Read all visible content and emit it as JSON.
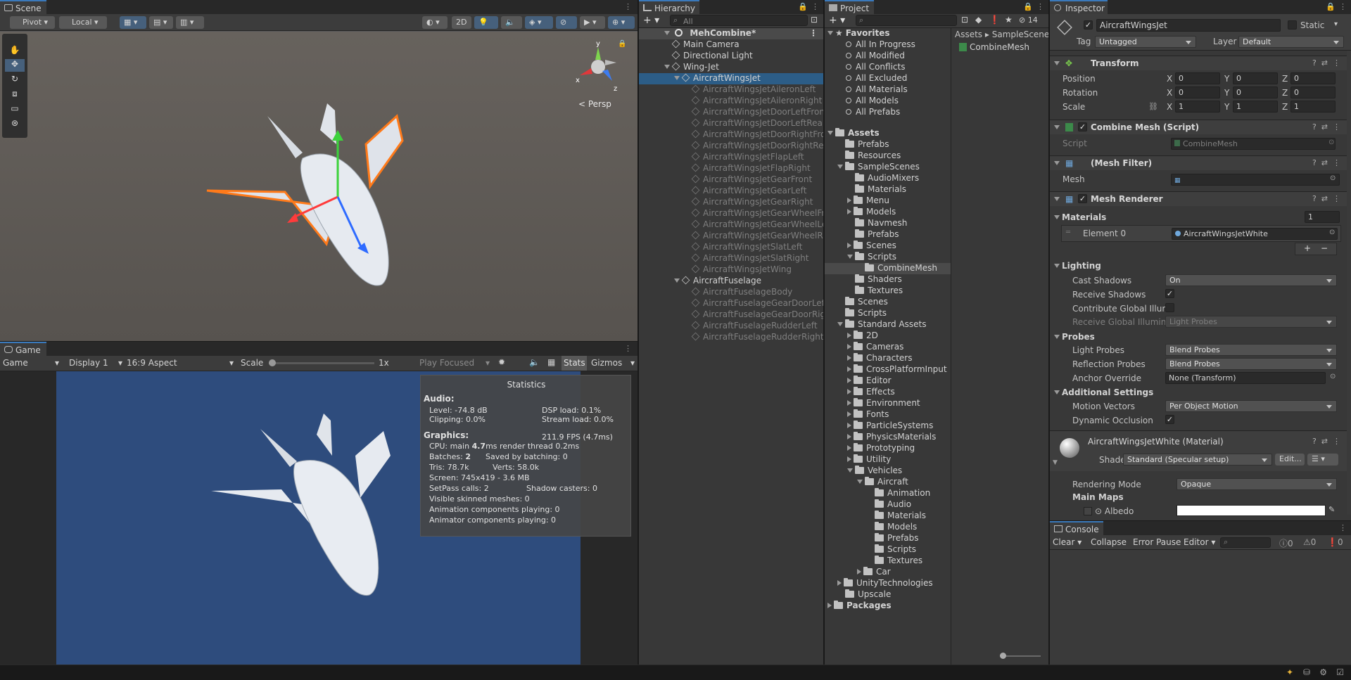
{
  "scene": {
    "tab_label": "Scene",
    "pivot_label": "Pivot",
    "local_label": "Local",
    "mode_2d": "2D",
    "persp_label": "< Persp",
    "gizmo_axes": [
      "y",
      "x",
      "z"
    ]
  },
  "game": {
    "tab_label": "Game",
    "mode": "Game",
    "display": "Display 1",
    "aspect": "16:9 Aspect",
    "scale_label": "Scale",
    "scale_value": "1x",
    "play_focused": "Play Focused",
    "stats_label": "Stats",
    "gizmos_label": "Gizmos",
    "background_color": "#2e4c7d",
    "statistics": {
      "title": "Statistics",
      "audio_header": "Audio:",
      "level": "Level: -74.8 dB",
      "dsp_load": "DSP load: 0.1%",
      "clipping": "Clipping: 0.0%",
      "stream_load": "Stream load: 0.0%",
      "graphics_header": "Graphics:",
      "fps": "211.9 FPS (4.7ms)",
      "cpu_prefix": "CPU: main",
      "cpu_main": "4.7",
      "cpu_suffix": "ms  render thread 0.2ms",
      "batches_prefix": "Batches:",
      "batches_value": "2",
      "saved_by_batching": "Saved by batching: 0",
      "tris": "Tris: 78.7k",
      "verts": "Verts: 58.0k",
      "screen": "Screen: 745x419 - 3.6 MB",
      "setpass": "SetPass calls: 2",
      "shadow_casters": "Shadow casters: 0",
      "skinned_meshes": "Visible skinned meshes: 0",
      "animation_components": "Animation components playing: 0",
      "animator_components": "Animator components playing: 0"
    }
  },
  "hierarchy": {
    "tab_label": "Hierarchy",
    "search_placeholder": "All",
    "scene_name": "MehCombine*",
    "items": [
      {
        "label": "Main Camera",
        "indent": 1,
        "dim": false,
        "fold": "none"
      },
      {
        "label": "Directional Light",
        "indent": 1,
        "dim": false,
        "fold": "none"
      },
      {
        "label": "Wing-Jet",
        "indent": 1,
        "dim": false,
        "fold": "open"
      },
      {
        "label": "AircraftWingsJet",
        "indent": 2,
        "dim": false,
        "fold": "open",
        "selected": true
      },
      {
        "label": "AircraftWingsJetAileronLeft",
        "indent": 3,
        "dim": true,
        "fold": "none"
      },
      {
        "label": "AircraftWingsJetAileronRight",
        "indent": 3,
        "dim": true,
        "fold": "none"
      },
      {
        "label": "AircraftWingsJetDoorLeftFront",
        "indent": 3,
        "dim": true,
        "fold": "none"
      },
      {
        "label": "AircraftWingsJetDoorLeftRear",
        "indent": 3,
        "dim": true,
        "fold": "none"
      },
      {
        "label": "AircraftWingsJetDoorRightFront",
        "indent": 3,
        "dim": true,
        "fold": "none"
      },
      {
        "label": "AircraftWingsJetDoorRightRear",
        "indent": 3,
        "dim": true,
        "fold": "none"
      },
      {
        "label": "AircraftWingsJetFlapLeft",
        "indent": 3,
        "dim": true,
        "fold": "none"
      },
      {
        "label": "AircraftWingsJetFlapRight",
        "indent": 3,
        "dim": true,
        "fold": "none"
      },
      {
        "label": "AircraftWingsJetGearFront",
        "indent": 3,
        "dim": true,
        "fold": "none"
      },
      {
        "label": "AircraftWingsJetGearLeft",
        "indent": 3,
        "dim": true,
        "fold": "none"
      },
      {
        "label": "AircraftWingsJetGearRight",
        "indent": 3,
        "dim": true,
        "fold": "none"
      },
      {
        "label": "AircraftWingsJetGearWheelFront",
        "indent": 3,
        "dim": true,
        "fold": "none"
      },
      {
        "label": "AircraftWingsJetGearWheelLeft",
        "indent": 3,
        "dim": true,
        "fold": "none"
      },
      {
        "label": "AircraftWingsJetGearWheelRight",
        "indent": 3,
        "dim": true,
        "fold": "none"
      },
      {
        "label": "AircraftWingsJetSlatLeft",
        "indent": 3,
        "dim": true,
        "fold": "none"
      },
      {
        "label": "AircraftWingsJetSlatRight",
        "indent": 3,
        "dim": true,
        "fold": "none"
      },
      {
        "label": "AircraftWingsJetWing",
        "indent": 3,
        "dim": true,
        "fold": "none"
      },
      {
        "label": "AircraftFuselage",
        "indent": 2,
        "dim": false,
        "fold": "open"
      },
      {
        "label": "AircraftFuselageBody",
        "indent": 3,
        "dim": true,
        "fold": "none"
      },
      {
        "label": "AircraftFuselageGearDoorLeft",
        "indent": 3,
        "dim": true,
        "fold": "none"
      },
      {
        "label": "AircraftFuselageGearDoorRight",
        "indent": 3,
        "dim": true,
        "fold": "none"
      },
      {
        "label": "AircraftFuselageRudderLeft",
        "indent": 3,
        "dim": true,
        "fold": "none"
      },
      {
        "label": "AircraftFuselageRudderRight",
        "indent": 3,
        "dim": true,
        "fold": "none"
      }
    ]
  },
  "project": {
    "tab_label": "Project",
    "hidden_count": "14",
    "favorites_label": "Favorites",
    "favorites": [
      "All In Progress",
      "All Modified",
      "All Conflicts",
      "All Excluded",
      "All Materials",
      "All Models",
      "All Prefabs"
    ],
    "assets_label": "Assets",
    "tree": [
      {
        "label": "Prefabs",
        "indent": 1,
        "fold": "none"
      },
      {
        "label": "Resources",
        "indent": 1,
        "fold": "none"
      },
      {
        "label": "SampleScenes",
        "indent": 1,
        "fold": "open"
      },
      {
        "label": "AudioMixers",
        "indent": 2,
        "fold": "none"
      },
      {
        "label": "Materials",
        "indent": 2,
        "fold": "none"
      },
      {
        "label": "Menu",
        "indent": 2,
        "fold": "closed"
      },
      {
        "label": "Models",
        "indent": 2,
        "fold": "closed"
      },
      {
        "label": "Navmesh",
        "indent": 2,
        "fold": "none"
      },
      {
        "label": "Prefabs",
        "indent": 2,
        "fold": "none"
      },
      {
        "label": "Scenes",
        "indent": 2,
        "fold": "closed"
      },
      {
        "label": "Scripts",
        "indent": 2,
        "fold": "open"
      },
      {
        "label": "CombineMesh",
        "indent": 3,
        "fold": "none",
        "highlight": true
      },
      {
        "label": "Shaders",
        "indent": 2,
        "fold": "none"
      },
      {
        "label": "Textures",
        "indent": 2,
        "fold": "none"
      },
      {
        "label": "Scenes",
        "indent": 1,
        "fold": "none"
      },
      {
        "label": "Scripts",
        "indent": 1,
        "fold": "none"
      },
      {
        "label": "Standard Assets",
        "indent": 1,
        "fold": "open"
      },
      {
        "label": "2D",
        "indent": 2,
        "fold": "closed"
      },
      {
        "label": "Cameras",
        "indent": 2,
        "fold": "closed"
      },
      {
        "label": "Characters",
        "indent": 2,
        "fold": "closed"
      },
      {
        "label": "CrossPlatformInput",
        "indent": 2,
        "fold": "closed"
      },
      {
        "label": "Editor",
        "indent": 2,
        "fold": "closed"
      },
      {
        "label": "Effects",
        "indent": 2,
        "fold": "closed"
      },
      {
        "label": "Environment",
        "indent": 2,
        "fold": "closed"
      },
      {
        "label": "Fonts",
        "indent": 2,
        "fold": "closed"
      },
      {
        "label": "ParticleSystems",
        "indent": 2,
        "fold": "closed"
      },
      {
        "label": "PhysicsMaterials",
        "indent": 2,
        "fold": "closed"
      },
      {
        "label": "Prototyping",
        "indent": 2,
        "fold": "closed"
      },
      {
        "label": "Utility",
        "indent": 2,
        "fold": "closed"
      },
      {
        "label": "Vehicles",
        "indent": 2,
        "fold": "open"
      },
      {
        "label": "Aircraft",
        "indent": 3,
        "fold": "open"
      },
      {
        "label": "Animation",
        "indent": 4,
        "fold": "none"
      },
      {
        "label": "Audio",
        "indent": 4,
        "fold": "none"
      },
      {
        "label": "Materials",
        "indent": 4,
        "fold": "none"
      },
      {
        "label": "Models",
        "indent": 4,
        "fold": "none"
      },
      {
        "label": "Prefabs",
        "indent": 4,
        "fold": "none"
      },
      {
        "label": "Scripts",
        "indent": 4,
        "fold": "none"
      },
      {
        "label": "Textures",
        "indent": 4,
        "fold": "none"
      },
      {
        "label": "Car",
        "indent": 3,
        "fold": "closed"
      },
      {
        "label": "UnityTechnologies",
        "indent": 1,
        "fold": "closed"
      },
      {
        "label": "Upscale",
        "indent": 1,
        "fold": "none"
      },
      {
        "label": "Packages",
        "indent": 0,
        "fold": "closed",
        "bold": true
      }
    ],
    "breadcrumb": [
      "Assets",
      "SampleScenes"
    ],
    "file_item": "CombineMesh"
  },
  "inspector": {
    "tab_label": "Inspector",
    "object_name": "AircraftWingsJet",
    "static_label": "Static",
    "tag_label": "Tag",
    "tag_value": "Untagged",
    "layer_label": "Layer",
    "layer_value": "Default",
    "transform": {
      "title": "Transform",
      "position_label": "Position",
      "rotation_label": "Rotation",
      "scale_label": "Scale",
      "position": [
        "0",
        "0",
        "0"
      ],
      "rotation": [
        "0",
        "0",
        "0"
      ],
      "scale": [
        "1",
        "1",
        "1"
      ]
    },
    "combine_mesh": {
      "title": "Combine Mesh (Script)",
      "script_label": "Script",
      "script_value": "CombineMesh"
    },
    "mesh_filter": {
      "title": "(Mesh Filter)",
      "mesh_label": "Mesh",
      "mesh_value": ""
    },
    "mesh_renderer": {
      "title": "Mesh Renderer",
      "materials_label": "Materials",
      "materials_count": "1",
      "element0_label": "Element 0",
      "element0_value": "AircraftWingsJetWhite",
      "lighting_label": "Lighting",
      "cast_shadows_label": "Cast Shadows",
      "cast_shadows_value": "On",
      "receive_shadows_label": "Receive Shadows",
      "contribute_gi_label": "Contribute Global Illumi",
      "receive_gi_label": "Receive Global Illumina",
      "receive_gi_value": "Light Probes",
      "probes_label": "Probes",
      "light_probes_label": "Light Probes",
      "light_probes_value": "Blend Probes",
      "reflection_probes_label": "Reflection Probes",
      "reflection_probes_value": "Blend Probes",
      "anchor_override_label": "Anchor Override",
      "anchor_override_value": "None (Transform)",
      "additional_label": "Additional Settings",
      "motion_vectors_label": "Motion Vectors",
      "motion_vectors_value": "Per Object Motion",
      "dynamic_occlusion_label": "Dynamic Occlusion"
    },
    "material": {
      "title": "AircraftWingsJetWhite (Material)",
      "shader_label": "Shader",
      "shader_value": "Standard (Specular setup)",
      "edit_label": "Edit...",
      "rendering_mode_label": "Rendering Mode",
      "rendering_mode_value": "Opaque",
      "main_maps_label": "Main Maps",
      "albedo_label": "Albedo"
    }
  },
  "console": {
    "tab_label": "Console",
    "clear_label": "Clear",
    "collapse_label": "Collapse",
    "error_pause_label": "Error Pause",
    "editor_label": "Editor",
    "info_count": "0",
    "warn_count": "0",
    "error_count": "0"
  }
}
